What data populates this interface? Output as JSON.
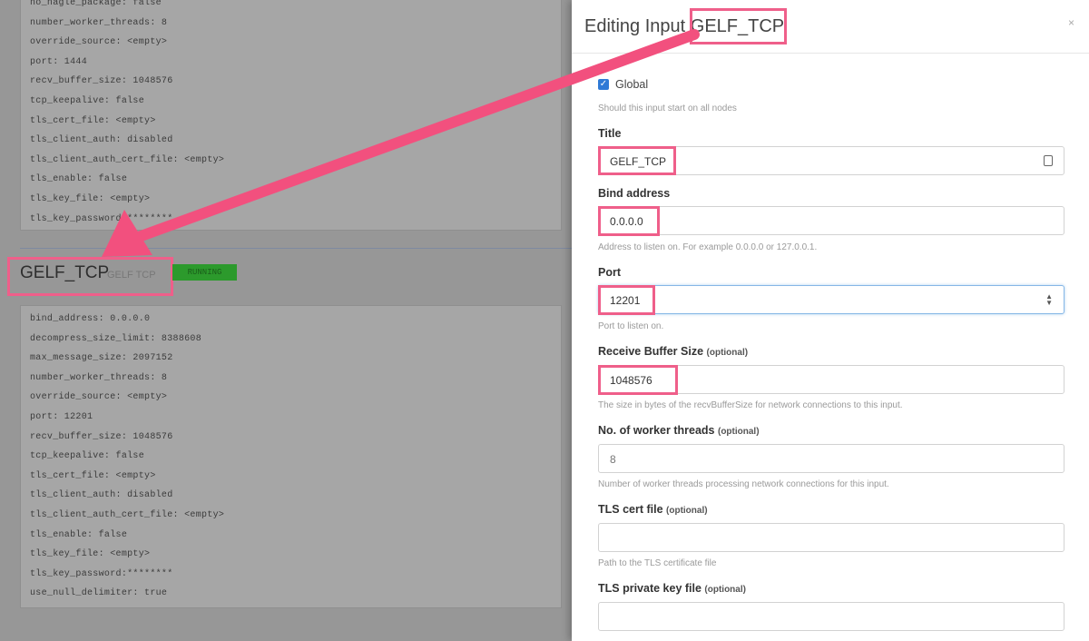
{
  "background": {
    "config_top": [
      "no_nagle_package: false",
      "number_worker_threads: 8",
      "override_source: <empty>",
      "port: 1444",
      "recv_buffer_size: 1048576",
      "tcp_keepalive: false",
      "tls_cert_file: <empty>",
      "tls_client_auth: disabled",
      "tls_client_auth_cert_file: <empty>",
      "tls_enable: false",
      "tls_key_file: <empty>",
      "tls_key_password:********"
    ],
    "input_name": "GELF_TCP",
    "input_type": "GELF TCP",
    "status_badge": "RUNNING",
    "config_bottom": [
      "bind_address: 0.0.0.0",
      "decompress_size_limit: 8388608",
      "max_message_size: 2097152",
      "number_worker_threads: 8",
      "override_source: <empty>",
      "port: 12201",
      "recv_buffer_size: 1048576",
      "tcp_keepalive: false",
      "tls_cert_file: <empty>",
      "tls_client_auth: disabled",
      "tls_client_auth_cert_file: <empty>",
      "tls_enable: false",
      "tls_key_file: <empty>",
      "tls_key_password:********",
      "use_null_delimiter: true"
    ]
  },
  "modal": {
    "title_prefix": "Editing Input",
    "title_name": "GELF_TCP",
    "close": "×",
    "global_label": "Global",
    "global_help": "Should this input start on all nodes",
    "fields": {
      "title": {
        "label": "Title",
        "value": "GELF_TCP"
      },
      "bind": {
        "label": "Bind address",
        "value": "0.0.0.0",
        "help": "Address to listen on. For example 0.0.0.0 or 127.0.0.1."
      },
      "port": {
        "label": "Port",
        "value": "12201",
        "help": "Port to listen on."
      },
      "recv": {
        "label": "Receive Buffer Size",
        "optional": "(optional)",
        "value": "1048576",
        "help": "The size in bytes of the recvBufferSize for network connections to this input."
      },
      "workers": {
        "label": "No. of worker threads",
        "optional": "(optional)",
        "value": "8",
        "help": "Number of worker threads processing network connections for this input."
      },
      "tls_cert": {
        "label": "TLS cert file",
        "optional": "(optional)",
        "value": "",
        "help": "Path to the TLS certificate file"
      },
      "tls_key": {
        "label": "TLS private key file",
        "optional": "(optional)",
        "value": ""
      }
    }
  },
  "colors": {
    "highlight": "#ef5f8a",
    "arrow": "#f2507e",
    "checkbox": "#2f7ad6",
    "running": "#2c9a2c"
  }
}
